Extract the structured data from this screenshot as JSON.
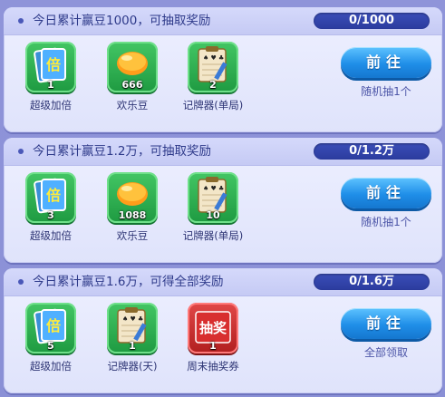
{
  "tasks": [
    {
      "title": "今日累计赢豆1000，可抽取奖励",
      "progress": "0/1000",
      "rewards": [
        {
          "icon": "double-card-icon",
          "count": "1",
          "label": "超级加倍"
        },
        {
          "icon": "bean-icon",
          "count": "666",
          "label": "欢乐豆"
        },
        {
          "icon": "card-counter-icon",
          "count": "2",
          "label": "记牌器(单局)"
        }
      ],
      "button": "前往",
      "note": "随机抽1个"
    },
    {
      "title": "今日累计赢豆1.2万，可抽取奖励",
      "progress": "0/1.2万",
      "rewards": [
        {
          "icon": "double-card-icon",
          "count": "3",
          "label": "超级加倍"
        },
        {
          "icon": "bean-icon",
          "count": "1088",
          "label": "欢乐豆"
        },
        {
          "icon": "card-counter-icon",
          "count": "10",
          "label": "记牌器(单局)"
        }
      ],
      "button": "前往",
      "note": "随机抽1个"
    },
    {
      "title": "今日累计赢豆1.6万，可得全部奖励",
      "progress": "0/1.6万",
      "rewards": [
        {
          "icon": "double-card-icon",
          "count": "5",
          "label": "超级加倍"
        },
        {
          "icon": "card-counter-icon",
          "count": "1",
          "label": "记牌器(天)"
        },
        {
          "icon": "weekend-lottery-ticket-icon",
          "count": "1",
          "label": "周末抽奖券",
          "ticket_text": "抽奖"
        }
      ],
      "button": "前往",
      "note": "全部领取"
    }
  ],
  "colors": {
    "background": "#8f94d9",
    "card": "#eef0ff",
    "progress_pill": "#2b3c9e",
    "button": "#1f8ee8",
    "icon_green": "#2aa84b",
    "icon_red": "#c12a2a"
  }
}
